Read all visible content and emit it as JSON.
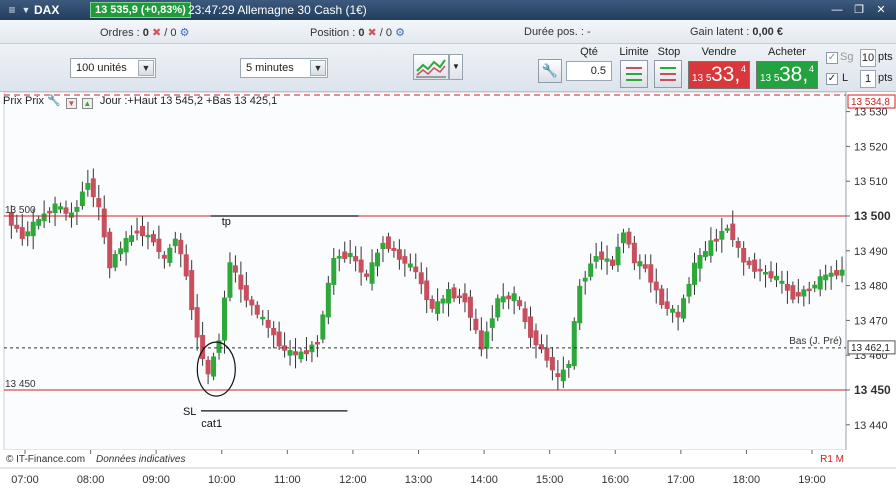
{
  "titlebar": {
    "symbol": "DAX",
    "price_badge": "13 535,9 (+0,83%)",
    "title": "23:47:29 Allemagne 30 Cash (1€)"
  },
  "status": {
    "orders_label": "Ordres :",
    "orders_value": "0",
    "orders_sep": "/ 0",
    "position_label": "Position :",
    "position_value": "0",
    "position_sep": "/ 0",
    "duree_label": "Durée pos. : -",
    "gain_label": "Gain latent :",
    "gain_value": "0,00 €"
  },
  "toolbar": {
    "units_select": "100 unités",
    "interval_select": "5 minutes",
    "qty_label": "Qté",
    "qty_value": "0.5",
    "limit_label": "Limite",
    "stop_label": "Stop",
    "sell_label": "Vendre",
    "buy_label": "Acheter",
    "sell_prefix": "13 5",
    "sell_big": "33,",
    "sell_small": "4",
    "buy_prefix": "13 5",
    "buy_big": "38,",
    "buy_small": "4",
    "sg_label": "Sg",
    "sg_value": "10",
    "sg_unit": "pts",
    "l_label": "L",
    "l_value": "1",
    "l_unit": "pts",
    "sell_color": "#d8383c",
    "buy_color": "#22a33f"
  },
  "chart": {
    "header_name": "Prix Prix",
    "header_info": "Jour :+Haut 13 545,2 +Bas 13 425,1",
    "footer_source": "© IT-Finance.com",
    "footer_note": "Données indicatives",
    "corner_label": "R1 M",
    "label_500": "13 500",
    "label_450": "13 450",
    "label_bas": "Bas (J. Pré)",
    "label_tp": "tp",
    "label_sl": "SL",
    "label_cat": "cat1",
    "current_price_tag": "13 534,8",
    "bas_price_tag": "13 462,1",
    "bull_color": "#2fa83a",
    "bear_color": "#c8505e"
  },
  "chart_data": {
    "type": "candlestick",
    "title": "",
    "y_ticks": [
      "13 530",
      "13 520",
      "13 510",
      "13 500",
      "13 490",
      "13 480",
      "13 470",
      "13 460",
      "13 450",
      "13 440"
    ],
    "x_ticks": [
      "07:00",
      "08:00",
      "09:00",
      "10:00",
      "11:00",
      "12:00",
      "13:00",
      "14:00",
      "15:00",
      "16:00",
      "17:00",
      "18:00",
      "19:00"
    ],
    "ylim": [
      13435,
      13533
    ],
    "horizontal_levels": [
      {
        "name": "tp / resistance",
        "value": 13500,
        "color": "#cc2222"
      },
      {
        "name": "SL / support",
        "value": 13450,
        "color": "#cc2222"
      },
      {
        "name": "Bas (J. Pré)",
        "value": 13462.1,
        "color": "#333333"
      },
      {
        "name": "last price",
        "value": 13534.8,
        "color": "#cc2222"
      }
    ],
    "close_path": [
      [
        "06:45",
        13500
      ],
      [
        "07:00",
        13494
      ],
      [
        "07:15",
        13499
      ],
      [
        "07:30",
        13503
      ],
      [
        "07:45",
        13500
      ],
      [
        "08:00",
        13510
      ],
      [
        "08:10",
        13502
      ],
      [
        "08:20",
        13486
      ],
      [
        "08:30",
        13491
      ],
      [
        "08:45",
        13496
      ],
      [
        "09:00",
        13493
      ],
      [
        "09:10",
        13487
      ],
      [
        "09:20",
        13494
      ],
      [
        "09:30",
        13483
      ],
      [
        "09:40",
        13465
      ],
      [
        "09:50",
        13454
      ],
      [
        "10:00",
        13465
      ],
      [
        "10:10",
        13487
      ],
      [
        "10:20",
        13479
      ],
      [
        "10:30",
        13474
      ],
      [
        "10:45",
        13468
      ],
      [
        "11:00",
        13461
      ],
      [
        "11:15",
        13460
      ],
      [
        "11:30",
        13464
      ],
      [
        "11:45",
        13488
      ],
      [
        "12:00",
        13489
      ],
      [
        "12:15",
        13482
      ],
      [
        "12:30",
        13493
      ],
      [
        "12:45",
        13488
      ],
      [
        "13:00",
        13484
      ],
      [
        "13:15",
        13473
      ],
      [
        "13:30",
        13478
      ],
      [
        "13:45",
        13476
      ],
      [
        "14:00",
        13462
      ],
      [
        "14:15",
        13476
      ],
      [
        "14:30",
        13477
      ],
      [
        "14:45",
        13466
      ],
      [
        "15:00",
        13459
      ],
      [
        "15:10",
        13453
      ],
      [
        "15:20",
        13458
      ],
      [
        "15:30",
        13480
      ],
      [
        "15:45",
        13489
      ],
      [
        "16:00",
        13486
      ],
      [
        "16:10",
        13496
      ],
      [
        "16:20",
        13487
      ],
      [
        "16:30",
        13485
      ],
      [
        "16:45",
        13475
      ],
      [
        "17:00",
        13471
      ],
      [
        "17:15",
        13486
      ],
      [
        "17:30",
        13492
      ],
      [
        "17:45",
        13497
      ],
      [
        "18:00",
        13487
      ],
      [
        "18:15",
        13484
      ],
      [
        "18:30",
        13482
      ],
      [
        "18:45",
        13477
      ],
      [
        "19:00",
        13479
      ],
      [
        "19:15",
        13483
      ],
      [
        "19:30",
        13484
      ]
    ]
  }
}
